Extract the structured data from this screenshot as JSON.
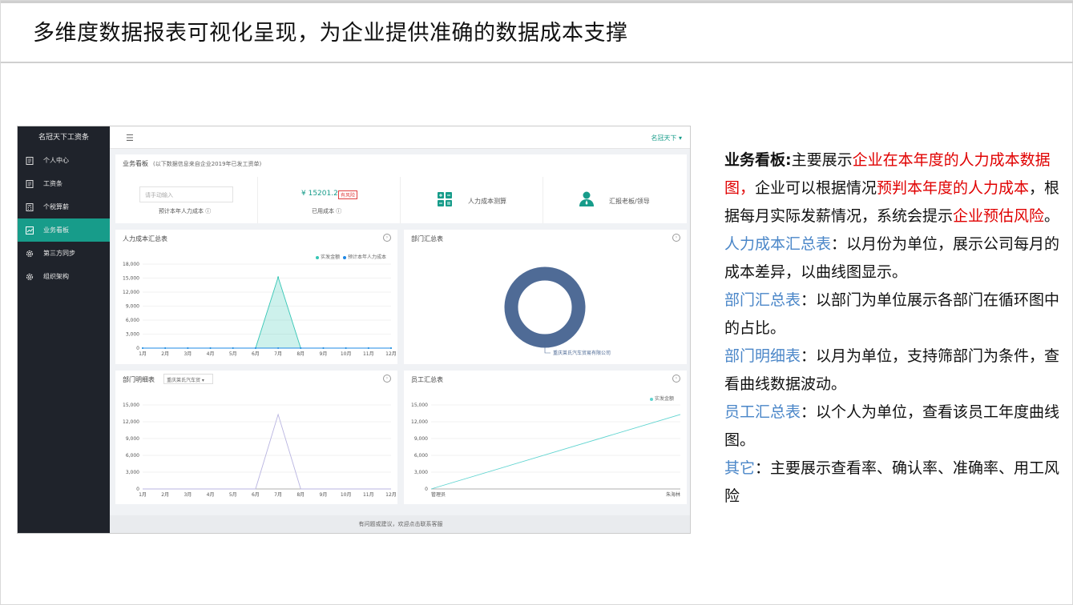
{
  "slide": {
    "title": "多维度数据报表可视化呈现，为企业提供准确的数据成本支撑"
  },
  "app": {
    "sidebar": {
      "title": "名冠天下工资条",
      "items": [
        {
          "label": "个人中心",
          "icon": "document-icon"
        },
        {
          "label": "工资条",
          "icon": "document-icon"
        },
        {
          "label": "个税算薪",
          "icon": "calculator-icon"
        },
        {
          "label": "业务看板",
          "icon": "chart-icon"
        },
        {
          "label": "第三方同步",
          "icon": "gear-icon"
        },
        {
          "label": "组织架构",
          "icon": "gear-icon"
        }
      ]
    },
    "topbar": {
      "menu_icon": "☰",
      "user": "名冠天下 ▾"
    },
    "dashboard": {
      "title": "业务看板",
      "subtitle": "(以下数据信息来自企业2019年已发工资单)",
      "input_placeholder": "请手动输入",
      "estimate_label": "预计本年人力成本 ⓘ",
      "used_value": "¥ 15201.2",
      "risk_badge": "有风险",
      "used_label": "已用成本 ⓘ",
      "calc_label": "人力成本测算",
      "report_label": "汇报老板/领导"
    },
    "cost_summary": {
      "title": "人力成本汇总表",
      "legend": [
        "实发金额",
        "预计本年人力成本"
      ]
    },
    "dept_summary": {
      "title": "部门汇总表",
      "legend": "重庆莱氏汽车贸易有限公司"
    },
    "dept_detail": {
      "title": "部门明细表",
      "select": "重庆莱氏汽车贸"
    },
    "staff_summary": {
      "title": "员工汇总表",
      "legend": "实发金额"
    },
    "footer": "有问题或建议，欢迎点击联系客服"
  },
  "chart_data": [
    {
      "type": "area",
      "title": "人力成本汇总表",
      "categories": [
        "1月",
        "2月",
        "3月",
        "4月",
        "5月",
        "6月",
        "7月",
        "8月",
        "9月",
        "10月",
        "11月",
        "12月"
      ],
      "ylim": [
        0,
        18000
      ],
      "yticks": [
        "18,000",
        "15,000",
        "12,000",
        "9,000",
        "6,000",
        "3,000",
        "0"
      ],
      "series": [
        {
          "name": "实发金额",
          "values": [
            0,
            0,
            0,
            0,
            0,
            0,
            15201,
            0,
            0,
            0,
            0,
            0
          ],
          "color": "#36c6b5"
        },
        {
          "name": "预计本年人力成本",
          "values": [
            0,
            0,
            0,
            0,
            0,
            0,
            0,
            0,
            0,
            0,
            0,
            0
          ],
          "color": "#1e88e5"
        }
      ]
    },
    {
      "type": "pie",
      "title": "部门汇总表",
      "categories": [
        "重庆莱氏汽车贸易有限公司"
      ],
      "values": [
        100
      ],
      "color": "#4f6b96"
    },
    {
      "type": "line",
      "title": "部门明细表",
      "categories": [
        "1月",
        "2月",
        "3月",
        "4月",
        "5月",
        "6月",
        "7月",
        "8月",
        "9月",
        "10月",
        "11月",
        "12月"
      ],
      "ylim": [
        0,
        15000
      ],
      "yticks": [
        "15,000",
        "12,000",
        "9,000",
        "6,000",
        "3,000",
        "0"
      ],
      "series": [
        {
          "values": [
            0,
            0,
            0,
            0,
            0,
            0,
            13300,
            0,
            0,
            0,
            0,
            0
          ],
          "color": "#b8b4e0"
        }
      ]
    },
    {
      "type": "line",
      "title": "员工汇总表",
      "categories": [
        "管理员",
        "朱海林"
      ],
      "ylim": [
        0,
        15000
      ],
      "yticks": [
        "15,000",
        "12,000",
        "9,000",
        "6,000",
        "3,000",
        "0"
      ],
      "series": [
        {
          "name": "实发金额",
          "values": [
            0,
            13300
          ],
          "color": "#5fd4d0"
        }
      ]
    }
  ],
  "notes": [
    [
      {
        "t": "业务看板:",
        "s": "bold"
      },
      {
        "t": "主要展示"
      },
      {
        "t": "企业在本年度的人力成本数据图，",
        "s": "red"
      },
      {
        "t": "企业可以根据情况"
      },
      {
        "t": "预判本年度的人力成本",
        "s": "red"
      },
      {
        "t": "，根据每月实际发薪情况，系统会提示"
      },
      {
        "t": "企业预估风险",
        "s": "red"
      },
      {
        "t": "。"
      }
    ],
    [
      {
        "t": "人力成本汇总表",
        "s": "blue"
      },
      {
        "t": "：以月份为单位，展示公司每月的成本差异，以曲线图显示。"
      }
    ],
    [
      {
        "t": "部门汇总表",
        "s": "blue"
      },
      {
        "t": "：以部门为单位展示各部门在循环图中的占比。"
      }
    ],
    [
      {
        "t": "部门明细表",
        "s": "blue"
      },
      {
        "t": "：以月为单位，支持筛部门为条件，查看曲线数据波动。"
      }
    ],
    [
      {
        "t": "员工汇总表",
        "s": "blue"
      },
      {
        "t": "：以个人为单位，查看该员工年度曲线图。"
      }
    ],
    [
      {
        "t": "其它",
        "s": "blue"
      },
      {
        "t": "：主要展示查看率、确认率、准确率、用工风险"
      }
    ]
  ]
}
